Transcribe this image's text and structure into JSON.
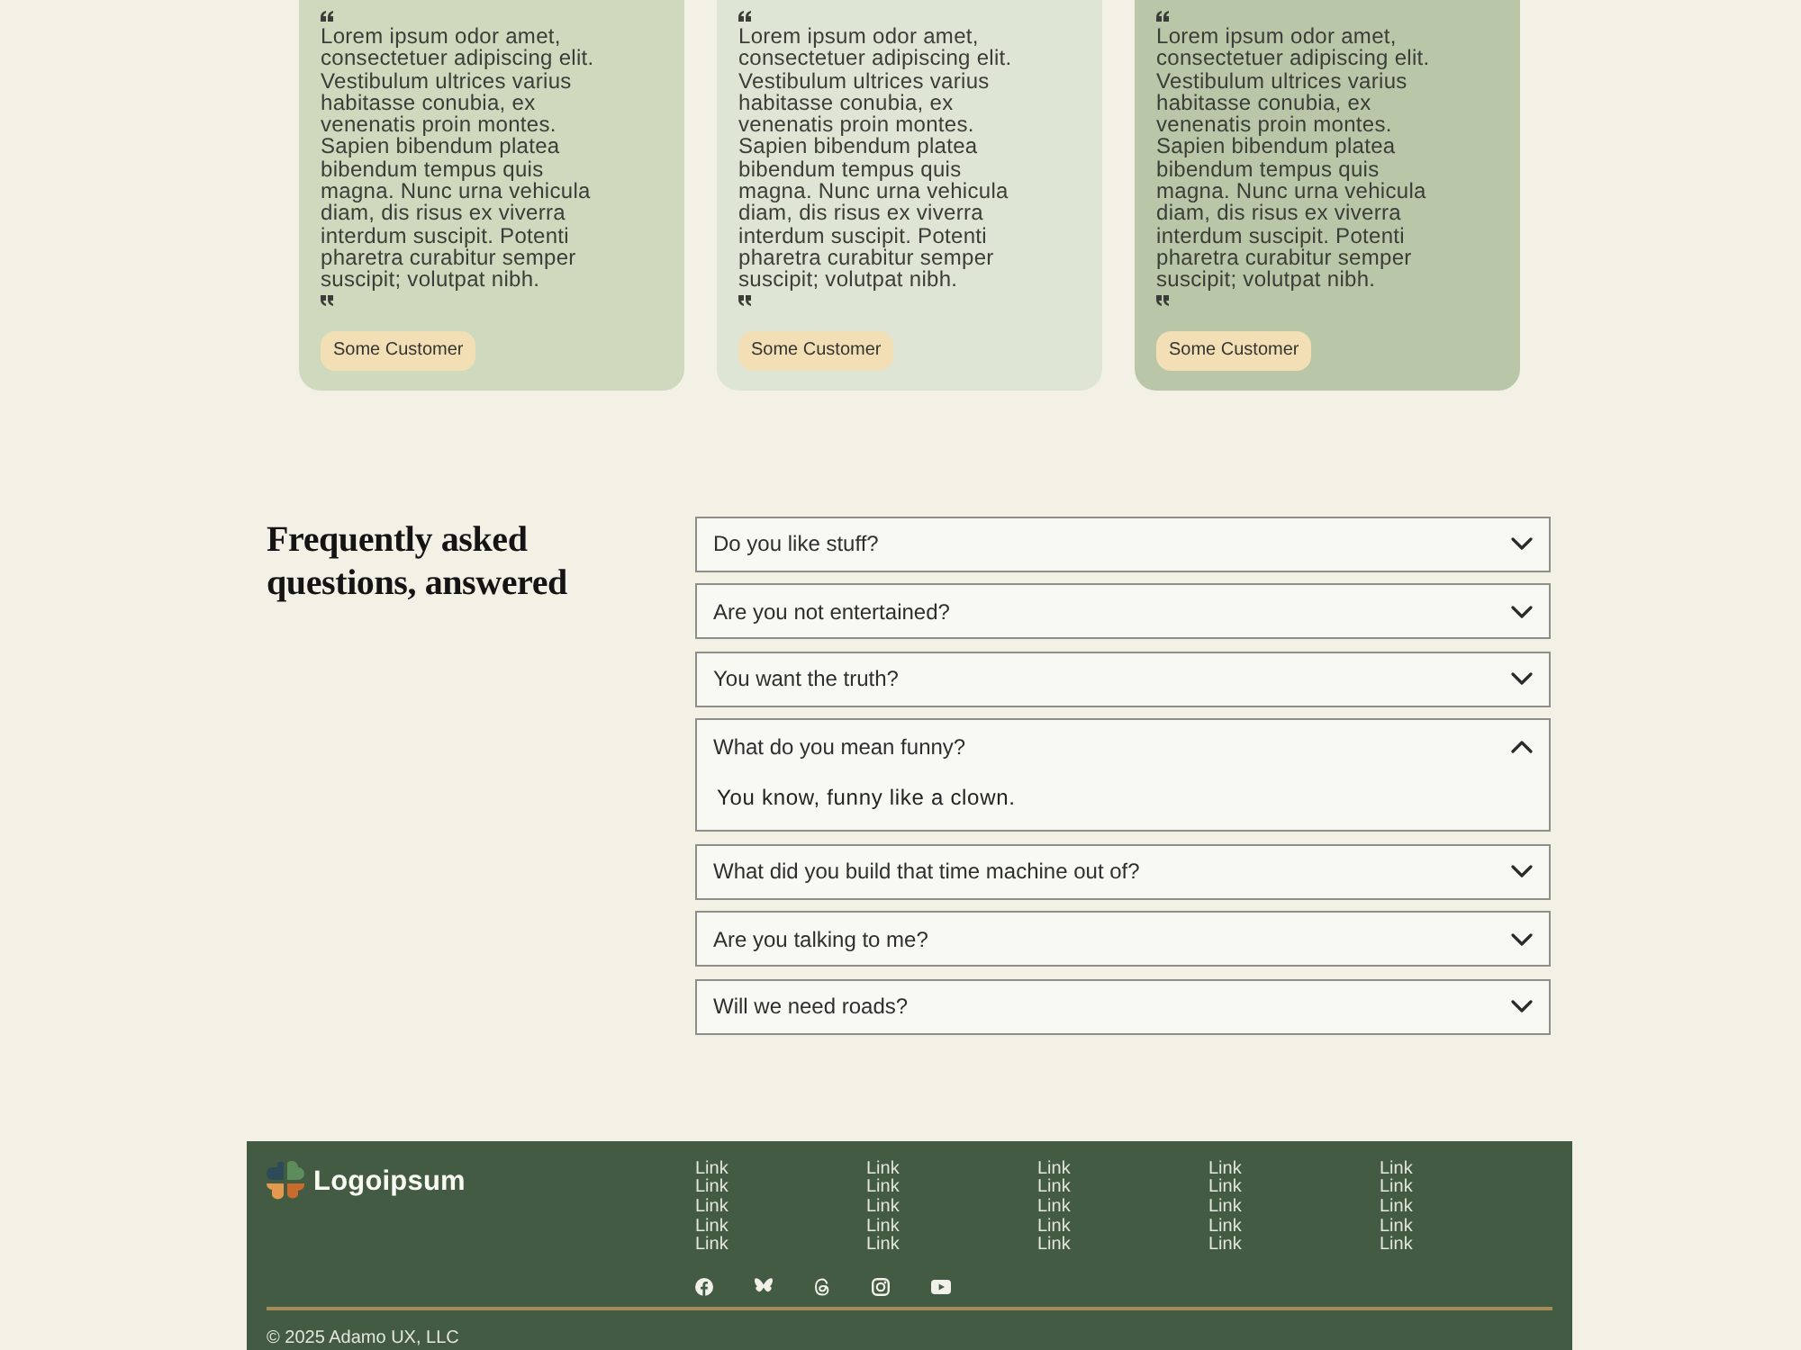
{
  "testimonials": [
    {
      "quote": "Lorem ipsum odor amet, consectetuer adipiscing elit. Vestibulum ultrices varius habitasse conubia, ex venenatis proin montes. Sapien bibendum platea bibendum tempus quis magna. Nunc urna vehicula diam, dis risus ex viverra interdum suscipit. Potenti pharetra curabitur semper suscipit; volutpat nibh.",
      "customer": "Some Customer",
      "color": "#cfd9bd"
    },
    {
      "quote": "Lorem ipsum odor amet, consectetuer adipiscing elit. Vestibulum ultrices varius habitasse conubia, ex venenatis proin montes. Sapien bibendum platea bibendum tempus quis magna. Nunc urna vehicula diam, dis risus ex viverra interdum suscipit. Potenti pharetra curabitur semper suscipit; volutpat nibh.",
      "customer": "Some Customer",
      "color": "#dfe5d4"
    },
    {
      "quote": "Lorem ipsum odor amet, consectetuer adipiscing elit. Vestibulum ultrices varius habitasse conubia, ex venenatis proin montes. Sapien bibendum platea bibendum tempus quis magna. Nunc urna vehicula diam, dis risus ex viverra interdum suscipit. Potenti pharetra curabitur semper suscipit; volutpat nibh.",
      "customer": "Some Customer",
      "color": "#b9c6a7"
    }
  ],
  "faq": {
    "title": "Frequently asked questions, answered",
    "items": [
      {
        "question": "Do you like stuff?",
        "expanded": false
      },
      {
        "question": "Are you not entertained?",
        "expanded": false
      },
      {
        "question": "You want the truth?",
        "expanded": false
      },
      {
        "question": "What do you mean funny?",
        "expanded": true,
        "answer": "You know, funny like a clown."
      },
      {
        "question": "What did you build that time machine out of?",
        "expanded": false
      },
      {
        "question": "Are you talking to me?",
        "expanded": false
      },
      {
        "question": "Will we need roads?",
        "expanded": false
      }
    ]
  },
  "footer": {
    "logo": "Logoipsum",
    "link_columns": [
      {
        "links": [
          "Link",
          "Link",
          "Link",
          "Link",
          "Link"
        ]
      },
      {
        "links": [
          "Link",
          "Link",
          "Link",
          "Link",
          "Link"
        ]
      },
      {
        "links": [
          "Link",
          "Link",
          "Link",
          "Link",
          "Link"
        ]
      },
      {
        "links": [
          "Link",
          "Link",
          "Link",
          "Link",
          "Link"
        ]
      },
      {
        "links": [
          "Link",
          "Link",
          "Link",
          "Link",
          "Link"
        ]
      }
    ],
    "social": [
      {
        "kind": "facebook"
      },
      {
        "kind": "butterfly"
      },
      {
        "kind": "threads"
      },
      {
        "kind": "instagram"
      },
      {
        "kind": "youtube"
      }
    ],
    "copyright": "© 2025 Adamo UX, LLC"
  }
}
